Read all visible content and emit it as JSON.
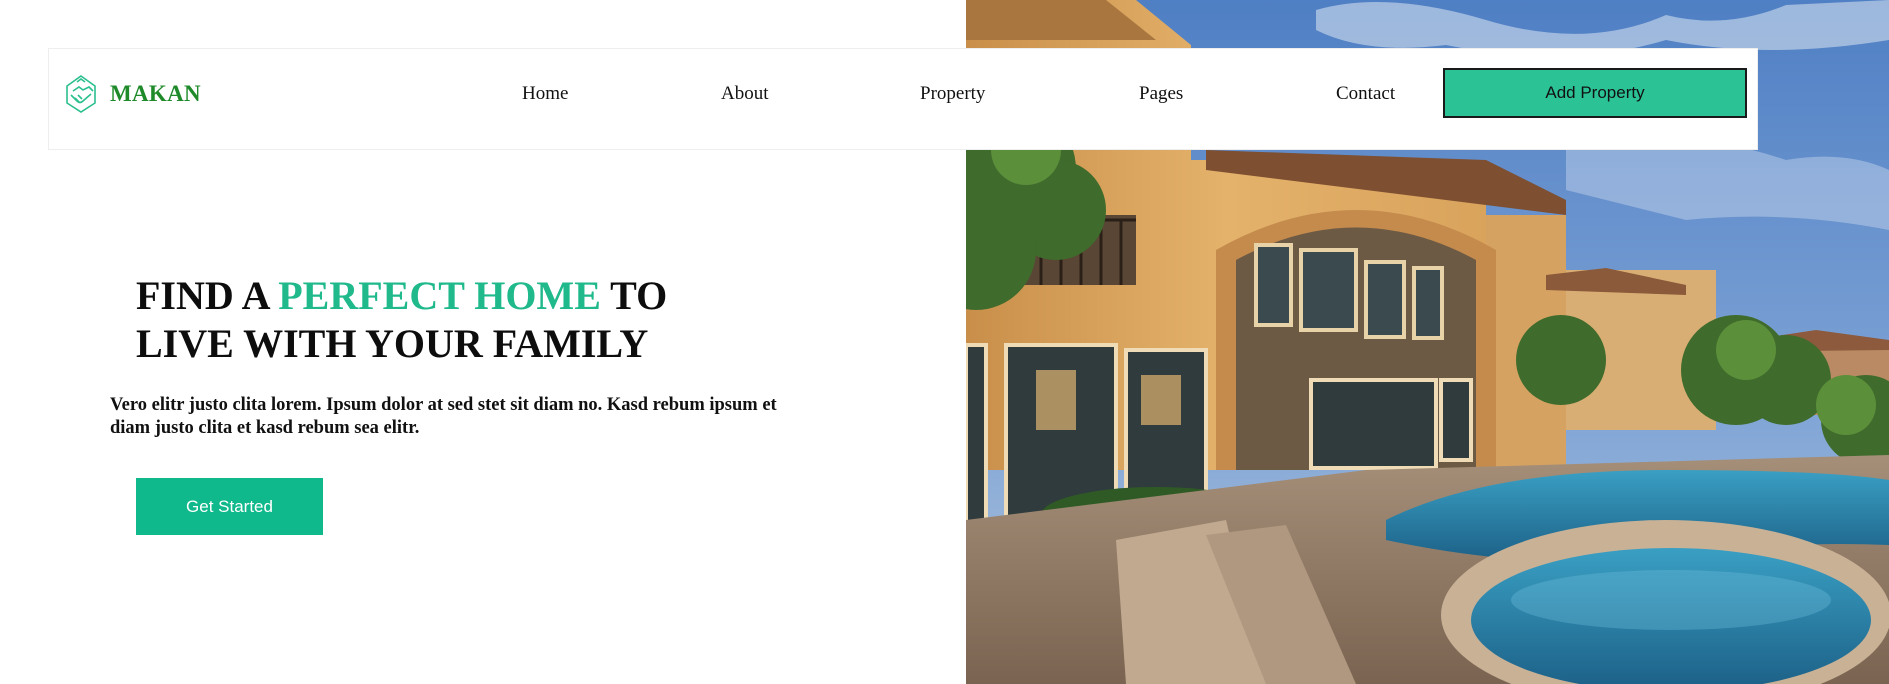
{
  "brand": {
    "name": "MAKAN",
    "icon": "handshake-house-icon",
    "color": "#1f8a2a"
  },
  "nav": {
    "items": [
      {
        "label": "Home"
      },
      {
        "label": "About"
      },
      {
        "label": "Property"
      },
      {
        "label": "Pages"
      },
      {
        "label": "Contact"
      }
    ],
    "cta_label": "Add Property"
  },
  "hero": {
    "headline_part1": "FIND A ",
    "headline_accent": "PERFECT HOME",
    "headline_part2": " TO",
    "headline_line2": "LIVE WITH YOUR FAMILY",
    "intro": "Vero elitr justo clita lorem. Ipsum dolor at sed stet sit diam no. Kasd rebum ipsum et diam justo clita et kasd rebum sea elitr.",
    "button_label": "Get Started",
    "image": "luxury-house-with-pool-photo"
  },
  "colors": {
    "accent": "#1fb98c",
    "button": "#0fb98b",
    "cta": "#2bc396"
  }
}
